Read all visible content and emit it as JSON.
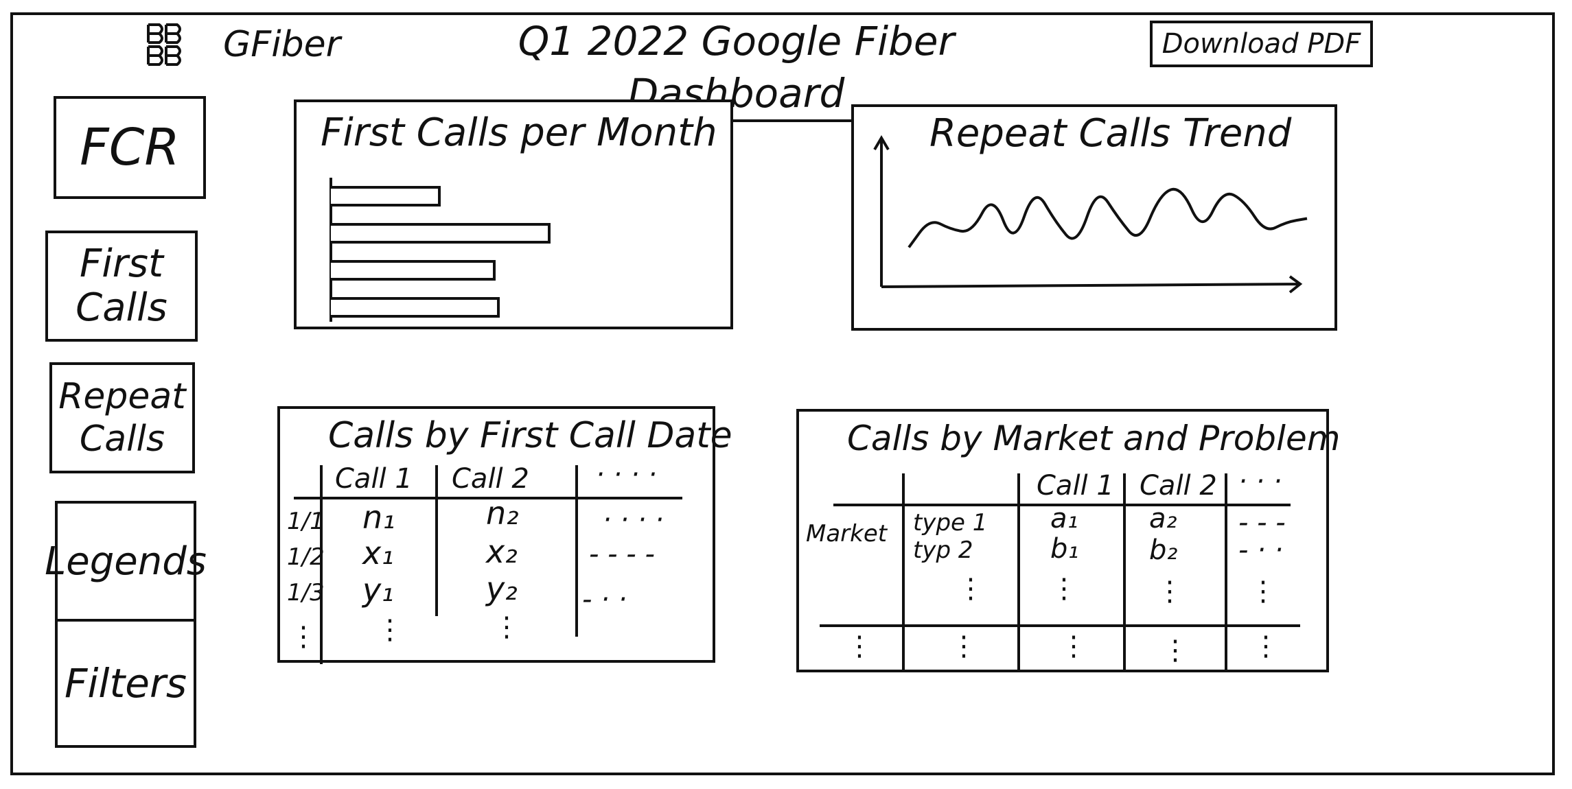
{
  "header": {
    "logo_icon": "gfiber-logo-icon",
    "logo_text": "GFiber",
    "title": "Q1 2022 Google Fiber Dashboard",
    "download_label": "Download PDF"
  },
  "sidebar": {
    "items": [
      {
        "label": "FCR"
      },
      {
        "label": "First\nCalls"
      },
      {
        "label": "Repeat\nCalls"
      },
      {
        "label": "Legends"
      },
      {
        "label": "Filters"
      }
    ]
  },
  "charts": {
    "first_calls": {
      "title": "First Calls per Month"
    },
    "repeat_calls": {
      "title": "Repeat Calls Trend"
    }
  },
  "chart_data": [
    {
      "type": "bar",
      "orientation": "horizontal",
      "title": "First Calls per Month",
      "categories": [
        "",
        "",
        "",
        ""
      ],
      "values": [
        0.5,
        1.0,
        0.75,
        0.77
      ],
      "xlabel": "",
      "ylabel": ""
    },
    {
      "type": "line",
      "title": "Repeat Calls Trend",
      "x": [
        0,
        1,
        2,
        3,
        4,
        5,
        6,
        7,
        8,
        9,
        10,
        11,
        12,
        13,
        14,
        15,
        16,
        17,
        18,
        19
      ],
      "values": [
        0.1,
        0.5,
        0.35,
        0.3,
        0.85,
        0.1,
        0.95,
        0.45,
        0.1,
        0.95,
        0.5,
        0.15,
        0.85,
        0.95,
        0.3,
        0.9,
        0.75,
        0.3,
        0.45,
        0.5
      ],
      "xlabel": "",
      "ylabel": ""
    }
  ],
  "table_first_call_date": {
    "title": "Calls by First Call Date",
    "headers": [
      "Call 1",
      "Call 2",
      "· · · ·"
    ],
    "rows": [
      {
        "date": "1/1",
        "c1": "n₁",
        "c2": "n₂",
        "more": "· · · ·"
      },
      {
        "date": "1/2",
        "c1": "x₁",
        "c2": "x₂",
        "more": "- - - -"
      },
      {
        "date": "1/3",
        "c1": "y₁",
        "c2": "y₂",
        "more": "- · ·"
      }
    ],
    "ellipsis": "⋮"
  },
  "table_market_problem": {
    "title": "Calls by Market and Problem",
    "headers": [
      "Call 1",
      "Call 2",
      "· · ·"
    ],
    "market_label": "Market",
    "types": [
      "type 1",
      "typ 2"
    ],
    "col1": [
      "a₁",
      "b₁"
    ],
    "col2": [
      "a₂",
      "b₂"
    ],
    "more": [
      "- - -",
      "- · ·"
    ],
    "ellipsis": "⋮"
  }
}
